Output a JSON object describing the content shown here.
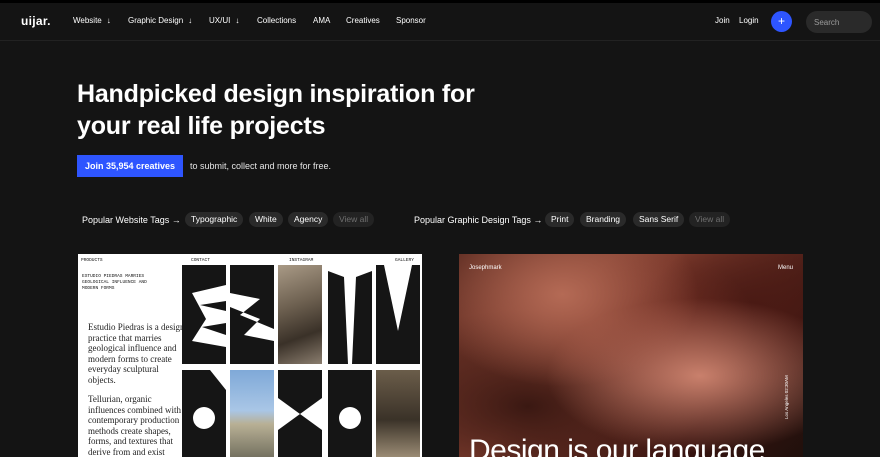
{
  "nav": {
    "logo": "uijar.",
    "items": [
      {
        "label": "Website",
        "chevron": "↓"
      },
      {
        "label": "Graphic Design",
        "chevron": "↓"
      },
      {
        "label": "UX/UI",
        "chevron": "↓"
      },
      {
        "label": "Collections"
      },
      {
        "label": "AMA"
      },
      {
        "label": "Creatives"
      },
      {
        "label": "Sponsor"
      }
    ],
    "join": "Join",
    "login": "Login",
    "plus": "+",
    "search_placeholder": "Search"
  },
  "hero": {
    "title": "Handpicked design inspiration for your real life projects",
    "cta": "Join 35,954 creatives",
    "cta_sub": "to submit, collect and more for free."
  },
  "website_tags": {
    "label": "Popular Website Tags →",
    "tags": [
      "Typographic",
      "White",
      "Agency"
    ],
    "view_all": "View all"
  },
  "graphic_tags": {
    "label": "Popular Graphic Design Tags →",
    "tags": [
      "Print",
      "Branding",
      "Sans Serif"
    ],
    "view_all": "View all"
  },
  "card1": {
    "top_nav": [
      "PRODUCTS",
      "CONTACT",
      "INSTAGRAM",
      "GALLERY"
    ],
    "small_text": "ESTUDIO PIEDRAS MARRIES GEOLOGICAL INFLUENCE AND MODERN FORMS",
    "para1": "Estudio Piedras is a design practice that marries geological influence and modern forms to create everyday sculptural objects.",
    "para2": "Tellurian, organic influences combined with contemporary production methods create shapes, forms, and textures that derive from and exist beyond the natural world."
  },
  "card2": {
    "brand": "Josephmark",
    "menu": "Menu",
    "side": "Los Angeles 02:30AM",
    "headline": "Design is our language"
  }
}
